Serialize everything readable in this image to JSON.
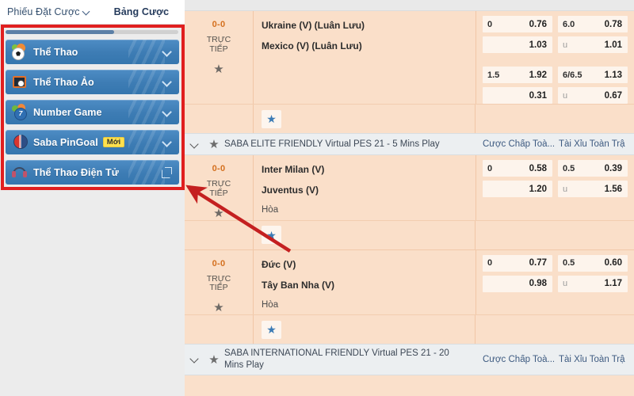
{
  "sidebar": {
    "tabs": [
      {
        "label": "Phiếu Đặt Cược",
        "has_caret": true
      },
      {
        "label": "Bảng Cược",
        "has_caret": false
      }
    ],
    "items": [
      {
        "label": "Thể Thao",
        "icon": "soccer-ball-icon",
        "badge": "",
        "action": "chevron-down-icon"
      },
      {
        "label": "Thể Thao Ảo",
        "icon": "virtual-sports-icon",
        "badge": "",
        "action": "chevron-down-icon"
      },
      {
        "label": "Number Game",
        "icon": "number-balls-icon",
        "badge": "",
        "action": "chevron-down-icon"
      },
      {
        "label": "Saba PinGoal",
        "icon": "pingoal-icon",
        "badge": "Mới",
        "action": "chevron-down-icon"
      },
      {
        "label": "Thể Thao Điện Tử",
        "icon": "esports-headset-icon",
        "badge": "",
        "action": "external-link-icon"
      }
    ]
  },
  "annotations": {
    "box_color": "#e01f1f",
    "arrow_color": "#c42020"
  },
  "content": {
    "top_partial_label": "",
    "column_headers": {
      "handicap": "Cược Chấp Toà...",
      "over_under": "Tài Xỉu Toàn Trậ"
    },
    "leagues": [
      {
        "name": "SABA ELITE FRIENDLY Virtual PES 21 - 5 Mins Play",
        "collapse_icon": "chevron-down-icon",
        "favorite_icon": "star-icon"
      },
      {
        "name": "SABA INTERNATIONAL FRIENDLY Virtual PES 21 - 20 Mins Play",
        "collapse_icon": "chevron-down-icon",
        "favorite_icon": "star-icon"
      }
    ],
    "matches": [
      {
        "score": "0-0",
        "live_line1": "TRỰC",
        "live_line2": "TIẾP",
        "home": "Ukraine (V) (Luân Lưu)",
        "away": "Mexico (V) (Luân Lưu)",
        "draw": "",
        "odds": [
          {
            "handicap": "0",
            "value": "0.76",
            "ou": "6.0",
            "ou_value": "0.78"
          },
          {
            "handicap": "",
            "value": "1.03",
            "ou": "u",
            "ou_value": "1.01"
          },
          {
            "handicap": "1.5",
            "value": "1.92",
            "ou": "6/6.5",
            "ou_value": "1.13"
          },
          {
            "handicap": "",
            "value": "0.31",
            "ou": "u",
            "ou_value": "0.67"
          }
        ]
      },
      {
        "score": "0-0",
        "live_line1": "TRỰC",
        "live_line2": "TIẾP",
        "home": "Inter Milan (V)",
        "away": "Juventus (V)",
        "draw": "Hòa",
        "odds": [
          {
            "handicap": "0",
            "value": "0.58",
            "ou": "0.5",
            "ou_value": "0.39"
          },
          {
            "handicap": "",
            "value": "1.20",
            "ou": "u",
            "ou_value": "1.56"
          }
        ]
      },
      {
        "score": "0-0",
        "live_line1": "TRỰC",
        "live_line2": "TIẾP",
        "home": "Đức (V)",
        "away": "Tây Ban Nha (V)",
        "draw": "Hòa",
        "odds": [
          {
            "handicap": "0",
            "value": "0.77",
            "ou": "0.5",
            "ou_value": "0.60"
          },
          {
            "handicap": "",
            "value": "0.98",
            "ou": "u",
            "ou_value": "1.17"
          }
        ]
      }
    ],
    "favorite_button_icon": "blue-star-icon"
  }
}
